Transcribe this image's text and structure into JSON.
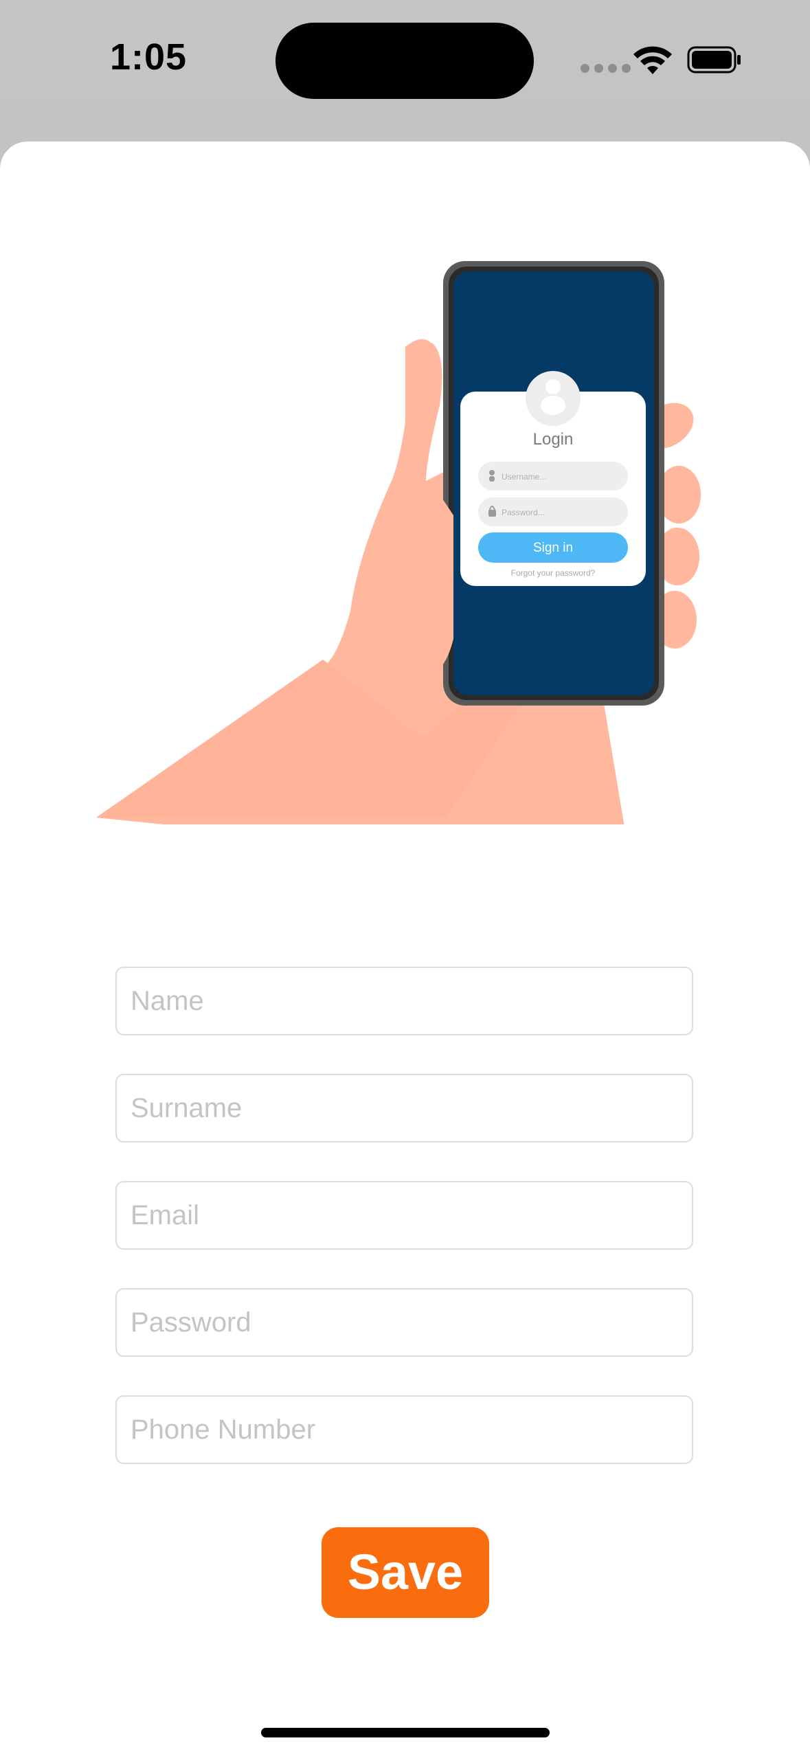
{
  "status_bar": {
    "time": "1:05",
    "wifi_icon": "wifi-icon",
    "battery_icon": "battery-icon"
  },
  "illustration": {
    "login_title": "Login",
    "username_placeholder": "Username...",
    "password_placeholder": "Password...",
    "sign_in_label": "Sign in",
    "forgot_label": "Forgot your password?"
  },
  "form": {
    "name_placeholder": "Name",
    "surname_placeholder": "Surname",
    "email_placeholder": "Email",
    "password_placeholder": "Password",
    "phone_placeholder": "Phone Number",
    "name_value": "",
    "surname_value": "",
    "email_value": "",
    "password_value": "",
    "phone_value": ""
  },
  "save_label": "Save",
  "colors": {
    "accent": "#f96d0e",
    "phone_screen": "#053a66",
    "sign_in_button": "#4db8f5",
    "skin": "#ffb79e"
  }
}
